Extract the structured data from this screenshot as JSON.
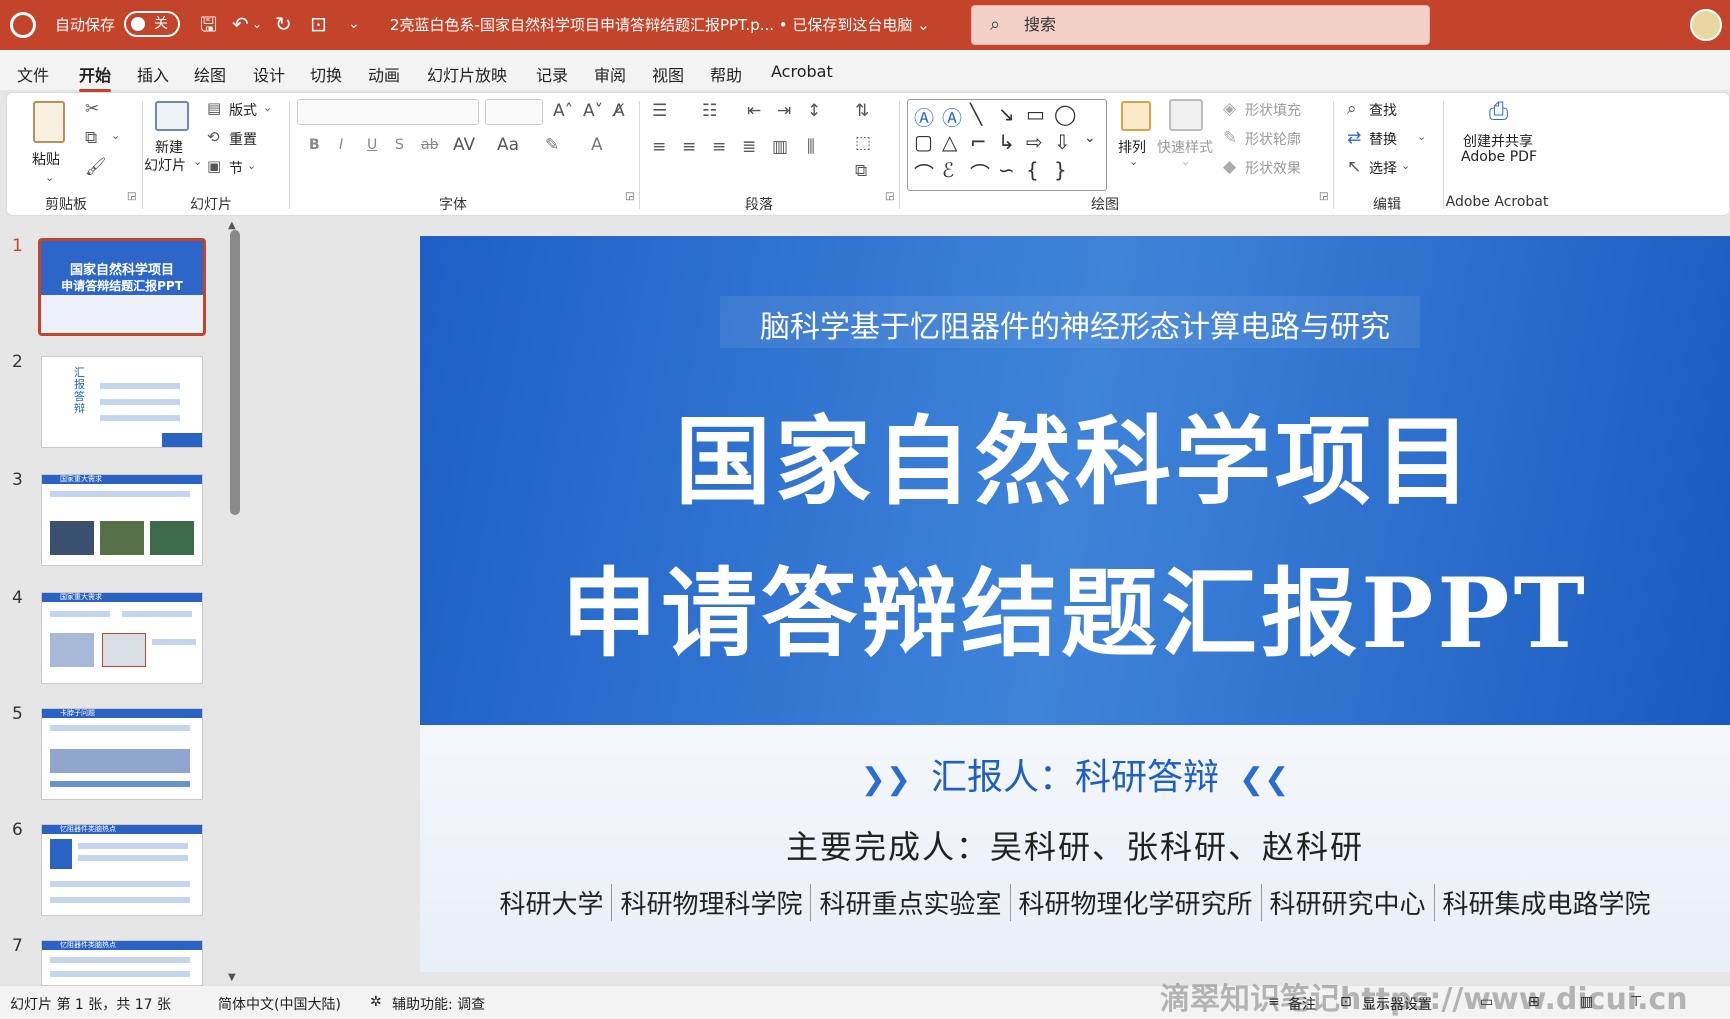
{
  "titlebar": {
    "autosave_label": "自动保存",
    "autosave_state": "关",
    "document_title": "2亮蓝白色系-国家自然科学项目申请答辩结题汇报PPT.p...  •  已保存到这台电脑 ⌄",
    "search_placeholder": "搜索"
  },
  "menu": [
    "文件",
    "开始",
    "插入",
    "绘图",
    "设计",
    "切换",
    "动画",
    "幻灯片放映",
    "记录",
    "审阅",
    "视图",
    "帮助",
    "Acrobat"
  ],
  "ribbon": {
    "clipboard": {
      "paste": "粘贴",
      "group": "剪贴板"
    },
    "slides": {
      "new_slide_1": "新建",
      "new_slide_2": "幻灯片",
      "layout": "版式",
      "reset": "重置",
      "section": "节",
      "group": "幻灯片"
    },
    "font": {
      "group": "字体",
      "bold": "B",
      "italic": "I",
      "underline": "U",
      "shadow": "S",
      "strike": "ab"
    },
    "paragraph": {
      "group": "段落"
    },
    "drawing": {
      "arrange": "排列",
      "quick_styles": "快速样式",
      "shape_fill": "形状填充",
      "shape_outline": "形状轮廓",
      "shape_effects": "形状效果",
      "group": "绘图"
    },
    "editing": {
      "find": "查找",
      "replace": "替换",
      "select": "选择",
      "group": "编辑"
    },
    "acrobat": {
      "line1": "创建并共享",
      "line2": "Adobe PDF",
      "group": "Adobe Acrobat"
    }
  },
  "thumbnails": [
    {
      "num": "1",
      "title_line1": "国家自然科学项目",
      "title_line2": "申请答辩结题汇报PPT"
    },
    {
      "num": "2",
      "title": "汇报答辩"
    },
    {
      "num": "3",
      "title": "国家重大需求"
    },
    {
      "num": "4",
      "title": "国家重大需求"
    },
    {
      "num": "5",
      "title": "卡脖子问题"
    },
    {
      "num": "6",
      "title": "忆阻器件类脑热点"
    },
    {
      "num": "7",
      "title": "忆阻器件类脑热点"
    }
  ],
  "slide": {
    "subtitle": "脑科学基于忆阻器件的神经形态计算电路与研究",
    "title_line1": "国家自然科学项目",
    "title_line2": "申请答辩结题汇报PPT",
    "reporter": "汇报人：科研答辩",
    "contributors": "主要完成人：吴科研、张科研、赵科研",
    "institutions": [
      "科研大学",
      "科研物理科学院",
      "科研重点实验室",
      "科研物理化学研究所",
      "科研研究中心",
      "科研集成电路学院"
    ]
  },
  "status": {
    "slide_info": "幻灯片 第 1 张，共 17 张",
    "language": "简体中文(中国大陆)",
    "accessibility": "辅助功能: 调查",
    "notes": "备注",
    "display_settings": "显示器设置"
  },
  "watermark": "滴翠知识笔记https://www.dicui.cn",
  "colors": {
    "accent": "#c4432b",
    "slide_blue": "#1d5fc6"
  }
}
